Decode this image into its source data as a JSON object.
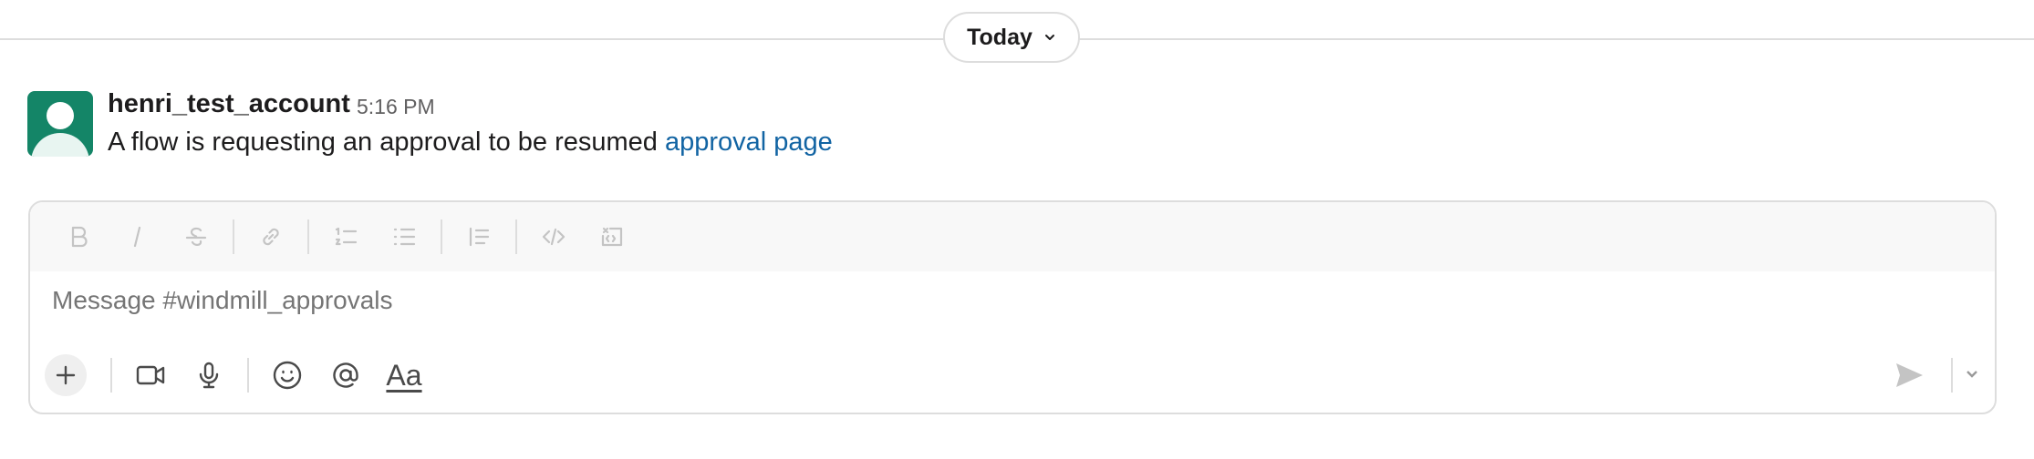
{
  "divider": {
    "label": "Today"
  },
  "message": {
    "author": "henri_test_account",
    "time": "5:16 PM",
    "text": "A flow is requesting an approval to be resumed",
    "link_text": "approval page"
  },
  "composer": {
    "placeholder": "Message #windmill_approvals",
    "format_tools": [
      "bold-icon",
      "italic-icon",
      "strikethrough-icon",
      "link-icon",
      "ordered-list-icon",
      "bulleted-list-icon",
      "blockquote-icon",
      "code-icon",
      "code-block-icon"
    ],
    "bottom_tools": [
      "plus-icon",
      "video-icon",
      "microphone-icon",
      "emoji-icon",
      "mention-icon",
      "formatting-icon"
    ],
    "format_label": "Aa"
  },
  "colors": {
    "avatar": "#148567",
    "link": "#1264a3",
    "text": "#1d1c1d",
    "muted": "#616061"
  }
}
